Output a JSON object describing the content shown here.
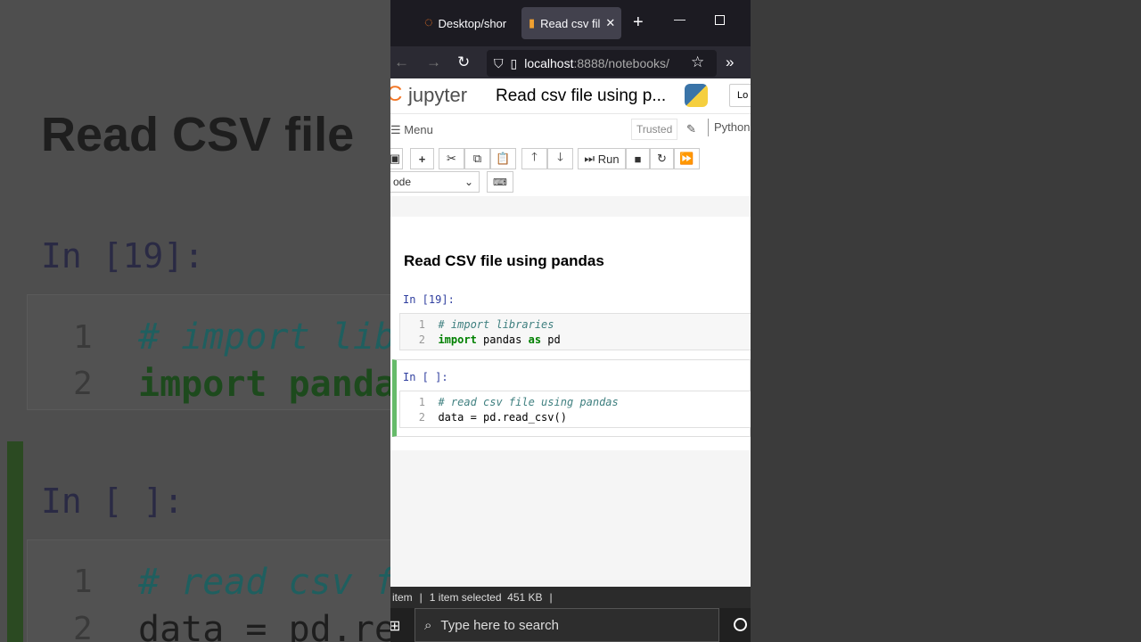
{
  "background": {
    "title": "Read CSV file",
    "prompt1": "In [19]:",
    "prompt2": "In [ ]:",
    "code1": [
      "# import lib",
      "import panda"
    ],
    "code2": [
      "# read csv f",
      "data = pd.re"
    ],
    "line_numbers": [
      "1",
      "2"
    ]
  },
  "browser": {
    "tabs": [
      {
        "label": "Desktop/shor"
      },
      {
        "label": "Read csv fil"
      }
    ],
    "url_host": "localhost",
    "url_rest": ":8888/notebooks/"
  },
  "jupyter": {
    "logo_text": "jupyter",
    "notebook_title": "Read csv file using p...",
    "login_label": "Lo",
    "menu_label": "Menu",
    "trusted_label": "Trusted",
    "kernel_label": "Python",
    "run_label": "Run",
    "cell_type": "ode"
  },
  "notebook": {
    "heading": "Read CSV file using pandas",
    "cells": [
      {
        "prompt": "In [19]:",
        "lines": [
          {
            "n": "1",
            "text": "# import libraries"
          },
          {
            "n": "2",
            "kw1": "import",
            "mid": " pandas ",
            "kw2": "as",
            "end": " pd"
          }
        ]
      },
      {
        "prompt": "In [ ]:",
        "lines": [
          {
            "n": "1",
            "text": "# read csv file using pandas"
          },
          {
            "n": "2",
            "text": "data = pd.read_csv()"
          }
        ]
      }
    ]
  },
  "statusbar": {
    "left": "item",
    "selected": "1 item selected  451 KB"
  },
  "taskbar": {
    "search_placeholder": "Type here to search"
  },
  "colors": {
    "accent": "#f37726",
    "cell_selected": "#66bb6a"
  }
}
